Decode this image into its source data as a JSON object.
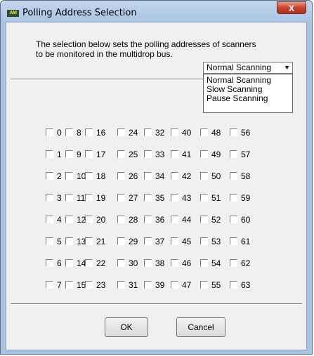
{
  "window": {
    "app_icon": "AM",
    "title": "Polling Address Selection",
    "close_icon": "X"
  },
  "description": {
    "line1": "The selection below sets the polling addresses of scanners",
    "line2": "to be monitored in the multidrop bus."
  },
  "scan_mode": {
    "selected": "Normal Scanning",
    "options": [
      "Normal Scanning",
      "Slow Scanning",
      "Pause Scanning"
    ]
  },
  "addresses": {
    "col0": [
      "0",
      "1",
      "2",
      "3",
      "4",
      "5",
      "6",
      "7"
    ],
    "col1": [
      "8",
      "9",
      "10",
      "11",
      "12",
      "13",
      "14",
      "15"
    ],
    "col2": [
      "16",
      "17",
      "18",
      "19",
      "20",
      "21",
      "22",
      "23"
    ],
    "col3": [
      "24",
      "25",
      "26",
      "27",
      "28",
      "29",
      "30",
      "31"
    ],
    "col4": [
      "32",
      "33",
      "34",
      "35",
      "36",
      "37",
      "38",
      "39"
    ],
    "col5": [
      "40",
      "41",
      "42",
      "43",
      "44",
      "45",
      "46",
      "47"
    ],
    "col6": [
      "48",
      "49",
      "50",
      "51",
      "52",
      "53",
      "54",
      "55"
    ],
    "col7": [
      "56",
      "57",
      "58",
      "59",
      "60",
      "61",
      "62",
      "63"
    ]
  },
  "buttons": {
    "ok": "OK",
    "cancel": "Cancel"
  }
}
